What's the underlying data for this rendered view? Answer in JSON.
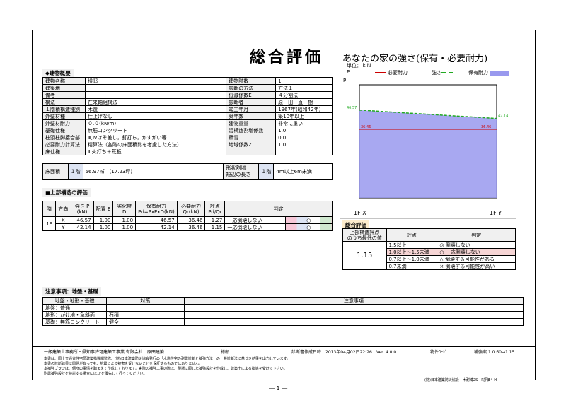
{
  "title": "総合評価",
  "subtitle": "あなたの家の強さ(保有・必要耐力)",
  "building": {
    "section_label": "◆建物概要",
    "rows": [
      {
        "k1": "建物名称",
        "v1": "様邸",
        "k2": "建物階数",
        "v2": "1"
      },
      {
        "k1": "建築地",
        "v1": "",
        "k2": "診断の方法",
        "v2": "方法１"
      },
      {
        "k1": "備考",
        "v1": "",
        "k2": "低減係数E",
        "v2": "４分割法"
      },
      {
        "k1": "構法",
        "v1": "在来軸組構法",
        "k2": "診断者",
        "v2": "原　田　直　樹"
      },
      {
        "k1": "１階積構造種別",
        "v1": "木造",
        "k2": "竣工年月",
        "v2": "1967年(昭和42年)"
      },
      {
        "k1": "外壁材種",
        "v1": "仕上げなし",
        "k2": "築年数",
        "v2": "築10年以上"
      },
      {
        "k1": "外壁材耐力",
        "v1": "０.０(kN/m)",
        "k2": "建物重量",
        "v2": "非常に重い"
      },
      {
        "k1": "基礎仕様",
        "v1": "無筋コンクリート",
        "k2": "混構造割増係数",
        "v2": "1.0"
      },
      {
        "k1": "柱頭柱脚接合部",
        "v1": "Ⅲ,Ⅳほぞ差し，釘打ち，かすがい等",
        "k2": "積雪",
        "v2": "0.0"
      },
      {
        "k1": "必要耐力計算法",
        "v1": "精算法（各階の床面積比を考慮した方法）",
        "k2": "地域係数Z",
        "v2": "1.0"
      },
      {
        "k1": "床仕様",
        "v1": "Ⅱ 火打ち＋荒板",
        "k2": "",
        "v2": ""
      }
    ],
    "floor_area_label": "床面積",
    "floor_1f_label": "１階",
    "floor_area_value": "56.97㎡　(17.23坪)",
    "shape_label": "形状割増\n短辺の長さ",
    "shape_floor": "１階",
    "shape_value": "4m以上6m未満"
  },
  "upper": {
    "section_label": "■上部構造の評価",
    "headers": [
      "階",
      "方向",
      "強さ P\n(kN)",
      "配置 E",
      "劣化度 D",
      "保有耐力\nPd=PxExD(kN)",
      "必要耐力\nQr(kN)",
      "評点\nPd/Qr",
      "判定"
    ],
    "floor": "1F",
    "rows": [
      {
        "dir": "X",
        "p": "46.57",
        "e": "1.00",
        "d": "1.00",
        "pd": "46.57",
        "qr": "36.46",
        "score": "1.27",
        "judge": "一応倒壊しない",
        "mark": "○"
      },
      {
        "dir": "Y",
        "p": "42.14",
        "e": "1.00",
        "d": "1.00",
        "pd": "42.14",
        "qr": "36.46",
        "score": "1.15",
        "judge": "一応倒壊しない",
        "mark": "○"
      }
    ],
    "scale_labels": "0.7 1.0  1.5"
  },
  "chart_data": {
    "type": "line",
    "title": "",
    "unit_label": "単位：ｋＮ",
    "y_axis_label": "P",
    "categories": [
      "1F X",
      "1F Y"
    ],
    "series": [
      {
        "name": "必要耐力",
        "values": [
          36.46,
          36.46
        ],
        "color": "#cc0000"
      },
      {
        "name": "強さ",
        "values": [
          46.57,
          42.14
        ],
        "color": "#22aa22"
      },
      {
        "name": "保有耐力",
        "values": [
          46.57,
          42.14
        ],
        "color": "#9999ee"
      }
    ],
    "ylim": [
      0,
      60
    ]
  },
  "overall": {
    "section_label": "総合評価",
    "h1": "上部構造評点\nのうち最低の値",
    "h2": "評点",
    "h3": "判定",
    "value": "1.15",
    "levels": [
      {
        "range": "1.5以上",
        "judge": "◎ 倒壊しない",
        "hl": false
      },
      {
        "range": "1.0以上〜1.5未満",
        "judge": "○ 一応倒壊しない",
        "hl": true
      },
      {
        "range": "0.7以上〜1.0未満",
        "judge": "△ 倒壊する可能性がある",
        "hl": false
      },
      {
        "range": "0.7未満",
        "judge": "× 倒壊する可能性が高い",
        "hl": false
      }
    ]
  },
  "notes": {
    "section_label": "注意事項：地盤・基礎",
    "h1": "地盤・地形・基礎",
    "h2": "対策",
    "h3": "注意事項",
    "rows": [
      {
        "a": "地盤：普通",
        "b": ""
      },
      {
        "a": "地形：がけ地・急斜面",
        "b": "石積"
      },
      {
        "a": "基礎：無筋コンクリート",
        "b": "健全"
      }
    ]
  },
  "footer": {
    "office": "一級建築士事務所・県知事許可建築工事業 有限会社　原田建築",
    "client": "様邸",
    "date": "診断書作成日時：2013年04月02日22:26　Ver. 4.0.0",
    "code": "物件ｺｰﾄﾞ：",
    "ratio": "補強案 1 0.60→1.15",
    "lines": [
      "本書は、国土交通省住宅局建築指導課監修、(財)日本建築防災協会発行の「木造住宅の耐震診断と補強方法」の一般診断法に基づき結果を出力しています。",
      "本書の診断結果に問題が有っても、地震による被害を受けないことを保証するものではありません。",
      "本補強プランは、個々の事情を踏まえて作成しております。実際の補強工事の際は、現場に即した補強設計を作成し、建築士による指導を受けて下さい。",
      "耐震補強設計を検討する場合には1Fを優先して行ってください。"
    ],
    "publisher": "(財)日本建築防災協会　木耐博2S　P評価4-H",
    "page": "― 1 ―"
  }
}
